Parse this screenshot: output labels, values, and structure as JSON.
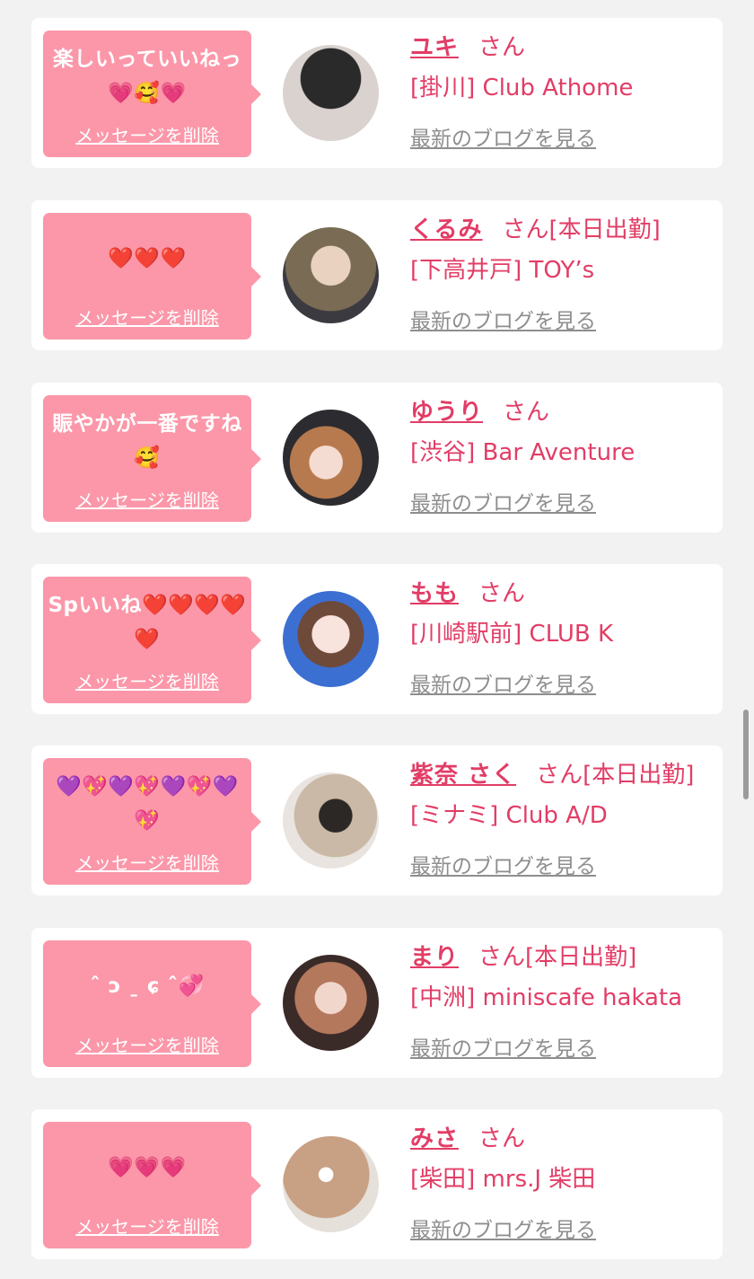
{
  "items": [
    {
      "message": "楽しいっていいねっ💗🥰💗",
      "delete_label": "メッセージを削除",
      "name": "ユキ",
      "honorific": "さん",
      "shop": "[掛川] Club Athome",
      "blog_label": "最新のブログを見る"
    },
    {
      "message": "❤️❤️❤️",
      "delete_label": "メッセージを削除",
      "name": "くるみ",
      "honorific": "さん[本日出勤]",
      "shop": "[下高井戸] TOY’s",
      "blog_label": "最新のブログを見る"
    },
    {
      "message": "賑やかが一番ですね🥰",
      "delete_label": "メッセージを削除",
      "name": "ゆうり",
      "honorific": "さん",
      "shop": "[渋谷] Bar Aventure",
      "blog_label": "最新のブログを見る"
    },
    {
      "message": "Spいいね❤️❤️❤️❤️❤️",
      "delete_label": "メッセージを削除",
      "name": "もも",
      "honorific": "さん",
      "shop": "[川崎駅前] CLUB K",
      "blog_label": "最新のブログを見る"
    },
    {
      "message": "💜💖💜💖💜💖💜💖",
      "delete_label": "メッセージを削除",
      "name": "紫奈 さく",
      "honorific": "さん[本日出勤]",
      "shop": "[ミナミ] Club A/D",
      "blog_label": "最新のブログを見る"
    },
    {
      "message": "ˆ ɔ ˍ ɕ ˆ💞",
      "delete_label": "メッセージを削除",
      "name": "まり",
      "honorific": "さん[本日出勤]",
      "shop": "[中洲] miniscafe hakata",
      "blog_label": "最新のブログを見る"
    },
    {
      "message": "💗💗💗",
      "delete_label": "メッセージを削除",
      "name": "みさ",
      "honorific": "さん",
      "shop": "[柴田] mrs.J 柴田",
      "blog_label": "最新のブログを見る"
    }
  ],
  "colors": {
    "background": "#f2f2f2",
    "bubble": "#fb97a9",
    "accent": "#e23d66",
    "blog_link": "#8e8e8e"
  }
}
